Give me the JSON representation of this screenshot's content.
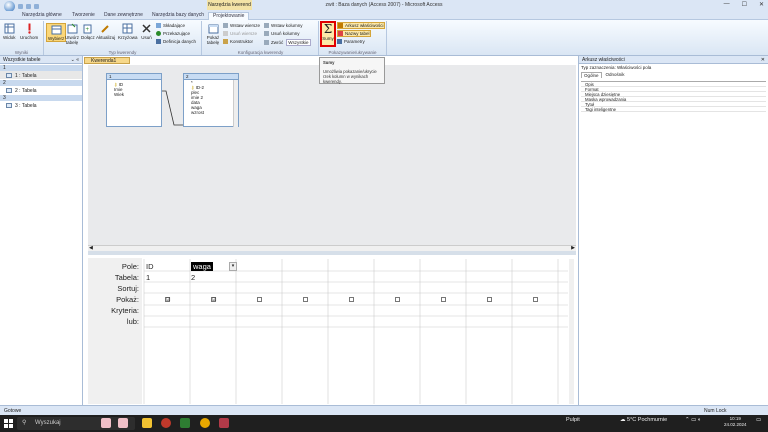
{
  "window": {
    "title": "zwit : Baza danych (Access 2007) - Microsoft Access",
    "context_header": "Narzędzia kwerend",
    "min": "—",
    "max": "☐",
    "close": "✕"
  },
  "tabs": [
    "Narzędzia główne",
    "Tworzenie",
    "Dane zewnętrzne",
    "Narzędzia bazy danych",
    "Projektowanie"
  ],
  "ribbon": {
    "wyniki": {
      "label": "Wyniki",
      "widok": "Widok",
      "uruchom": "Uruchom"
    },
    "typ": {
      "label": "Typ kwerendy",
      "wybierz": "Wybierz",
      "utworz": "Utwórz tabelę",
      "dolacz": "Dołącz",
      "aktualizuj": "Aktualizuj",
      "krzyzowa": "Krzyżowa",
      "usun": "Usuń",
      "sumujaca": "Składające",
      "przekazujaca": "Przekazujące",
      "definicja": "Definicja danych"
    },
    "konfig": {
      "label": "Konfiguracja kwerendy",
      "pokaz": "Pokaż tabelę",
      "wstaw_w": "Wstaw wiersze",
      "usun_w": "Usuń wiersze",
      "konstruktor": "Konstruktor",
      "wstaw_k": "Wstaw kolumny",
      "usun_k": "Usuń kolumny",
      "zwroc": "Zwróć",
      "wszystkie": "Wszystkie"
    },
    "pokaz_ukryj": {
      "label": "Pokazywanie/ukrywanie",
      "sumy": "Sumy",
      "sigma": "Σ",
      "arkusz": "Arkusz właściwości",
      "nazwy": "Nazwy tabel",
      "parametry": "Parametry"
    }
  },
  "tooltip": {
    "title": "Sumy",
    "text": "Umożliwia pokazanie/ukrycie rzek kolumn w wynikach kwerendy."
  },
  "nav": {
    "header": "Wszystkie tabele",
    "groups": [
      {
        "name": "1",
        "item": "1 : Tabela"
      },
      {
        "name": "2",
        "item": "2 : Tabela"
      },
      {
        "name": "3",
        "item": "3 : Tabela"
      }
    ]
  },
  "document_tab": "Kwerenda1",
  "tables": [
    {
      "name": "1",
      "fields": [
        "ID",
        "Imie",
        "Wiek"
      ]
    },
    {
      "name": "2",
      "fields": [
        "*",
        "ID-2",
        "plec",
        "imie 2",
        "data",
        "waga",
        "wzrost"
      ]
    }
  ],
  "grid": {
    "row_labels": [
      "Pole:",
      "Tabela:",
      "Sortuj:",
      "Pokaż:",
      "Kryteria:",
      "lub:"
    ],
    "col1": {
      "field": "ID",
      "table": "1"
    },
    "col2": {
      "field": "waga",
      "table": "2"
    },
    "checked": "☑"
  },
  "props": {
    "header": "Arkusz właściwości",
    "selection_label": "Typ zaznaczenia:",
    "selection": "Właściwości pola",
    "tab_general": "Ogólne",
    "tab_lookup": "Odnośnik",
    "rows": [
      "Opis",
      "Format",
      "Miejsca dziesiętne",
      "Maska wprowadzania",
      "Tytuł",
      "Tagi inteligentne"
    ]
  },
  "status": {
    "left": "Gotowe",
    "right": "Num Lock"
  },
  "taskbar": {
    "search": "Wyszukaj",
    "pulpit": "Pulpit",
    "weather": "5°C Pochmurnie",
    "time": "10:19",
    "date": "24.02.2024"
  },
  "colors": {
    "highlight": "#e00000",
    "ribbon": "#dae6f4",
    "taskbar": "#1f1f1f"
  }
}
